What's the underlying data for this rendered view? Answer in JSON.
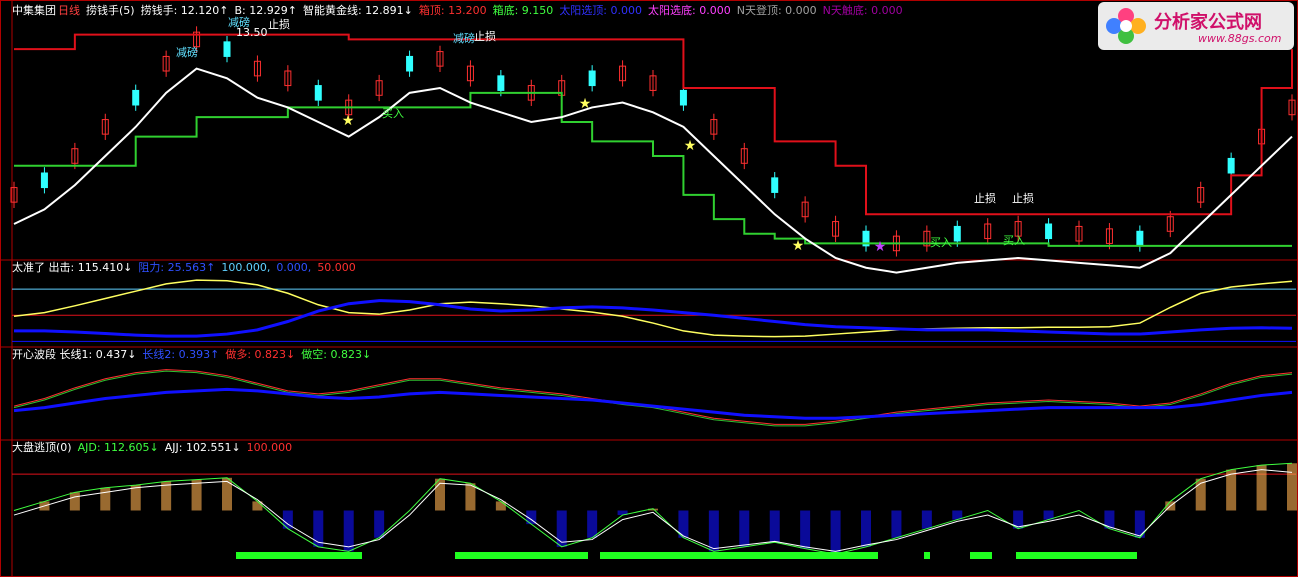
{
  "colors": {
    "bg": "#000000",
    "frame": "#b00000",
    "up_candle": "#ff3030",
    "down_candle": "#30ffff",
    "white_line": "#ffffff",
    "red_top": "#e0101a",
    "green_bottom": "#30d030",
    "yellow": "#ffff60",
    "blue": "#1010ff",
    "cyan": "#60d0ff",
    "orange": "#ffb050",
    "magenta": "#c040ff",
    "green_bar": "#20ff20"
  },
  "panel1": {
    "title": "中集集团",
    "period": "日线",
    "indicator": "捞钱手(5)",
    "values": [
      {
        "text": "捞钱手: 12.120↑",
        "color": "#ffffff"
      },
      {
        "text": "B: 12.929↑",
        "color": "#ffffff"
      },
      {
        "text": "智能黄金线: 12.891↓",
        "color": "#ffffff"
      },
      {
        "text": "箱顶: 13.200",
        "color": "#ff3030"
      },
      {
        "text": "箱底: 9.150",
        "color": "#40ff40"
      },
      {
        "text": "太阳选顶: 0.000",
        "color": "#3030ff"
      },
      {
        "text": "太阳选底: 0.000",
        "color": "#ff40ff"
      },
      {
        "text": "N天登顶: 0.000",
        "color": "#a0a0a0"
      },
      {
        "text": "N天触底: 0.000",
        "color": "#a000a0"
      }
    ],
    "annotations": [
      {
        "text": "减磅",
        "color": "#60e0ff"
      },
      {
        "text": "止损",
        "color": "#ffffff"
      },
      {
        "text": "减磅",
        "color": "#60e0ff"
      },
      {
        "text": "止损",
        "color": "#ffffff"
      },
      {
        "text": "减磅",
        "color": "#60e0ff"
      },
      {
        "text": "买入",
        "color": "#40ff40"
      },
      {
        "text": "止损",
        "color": "#ffffff"
      },
      {
        "text": "止损",
        "color": "#ffffff"
      },
      {
        "text": "买入",
        "color": "#40ff40"
      },
      {
        "text": "买入",
        "color": "#40ff40"
      },
      {
        "text": "13.50",
        "color": "#ffffff"
      }
    ]
  },
  "panel2": {
    "values": [
      {
        "text": "太准了 出击: 115.410↓",
        "color": "#ffffff"
      },
      {
        "text": "阻力: 25.563↑",
        "color": "#3050ff"
      },
      {
        "text": "100.000,",
        "color": "#60d0ff"
      },
      {
        "text": "0.000,",
        "color": "#3050ff"
      },
      {
        "text": "50.000",
        "color": "#ff3030"
      }
    ]
  },
  "panel3": {
    "values": [
      {
        "text": "开心波段 长线1: 0.437↓",
        "color": "#ffffff"
      },
      {
        "text": "长线2: 0.393↑",
        "color": "#3050ff"
      },
      {
        "text": "做多: 0.823↓",
        "color": "#ff3030"
      },
      {
        "text": "做空: 0.823↓",
        "color": "#40ff40"
      }
    ]
  },
  "panel4": {
    "values": [
      {
        "text": "大盘逃顶(0)",
        "color": "#ffffff"
      },
      {
        "text": "AJD: 112.605↓",
        "color": "#40ff40"
      },
      {
        "text": "AJJ: 102.551↓",
        "color": "#ffffff"
      },
      {
        "text": "100.000",
        "color": "#ff3030"
      }
    ]
  },
  "watermark": {
    "name": "分析家公式网",
    "url": "www.88gs.com"
  },
  "chart_data": {
    "type": "line",
    "series": [
      {
        "name": "捞钱手",
        "values": [
          10.2,
          10.5,
          11.0,
          11.6,
          12.2,
          12.9,
          13.4,
          13.2,
          12.8,
          12.6,
          12.3,
          12.0,
          12.4,
          12.9,
          13.0,
          12.7,
          12.5,
          12.3,
          12.4,
          12.6,
          12.7,
          12.5,
          12.2,
          11.6,
          11.0,
          10.4,
          9.9,
          9.5,
          9.3,
          9.2,
          9.3,
          9.4,
          9.45,
          9.5,
          9.45,
          9.4,
          9.35,
          9.3,
          9.6,
          10.2,
          10.8,
          11.4,
          12.0
        ]
      },
      {
        "name": "箱顶",
        "values": [
          13.2,
          13.2,
          13.5,
          13.5,
          13.5,
          13.5,
          13.5,
          13.5,
          13.5,
          13.5,
          13.5,
          13.4,
          13.4,
          13.4,
          13.4,
          13.4,
          13.4,
          13.4,
          13.4,
          13.4,
          13.4,
          13.4,
          12.4,
          12.4,
          12.4,
          11.3,
          11.3,
          10.8,
          9.8,
          9.8,
          9.8,
          9.8,
          9.8,
          9.8,
          9.8,
          9.8,
          9.8,
          9.8,
          9.8,
          9.8,
          10.6,
          12.4,
          13.2
        ]
      },
      {
        "name": "箱底",
        "values": [
          10.8,
          10.8,
          10.8,
          10.8,
          11.4,
          11.4,
          11.8,
          11.8,
          11.8,
          12.0,
          12.0,
          12.0,
          12.0,
          12.0,
          12.0,
          12.3,
          12.3,
          12.3,
          11.7,
          11.3,
          11.3,
          11.0,
          10.2,
          9.7,
          9.4,
          9.3,
          9.2,
          9.2,
          9.2,
          9.2,
          9.2,
          9.2,
          9.2,
          9.2,
          9.15,
          9.15,
          9.15,
          9.15,
          9.15,
          9.15,
          9.15,
          9.15,
          9.15
        ]
      },
      {
        "name": "出击",
        "values": [
          48,
          55,
          68,
          82,
          96,
          110,
          117,
          116,
          108,
          92,
          70,
          55,
          52,
          60,
          72,
          75,
          72,
          68,
          62,
          56,
          48,
          35,
          20,
          12,
          10,
          9,
          10,
          14,
          18,
          22,
          24,
          25,
          26,
          26,
          27,
          27,
          28,
          35,
          65,
          92,
          104,
          110,
          115
        ]
      },
      {
        "name": "阻力",
        "values": [
          20,
          20,
          18,
          15,
          12,
          10,
          10,
          14,
          22,
          38,
          58,
          72,
          78,
          76,
          70,
          62,
          58,
          60,
          64,
          66,
          64,
          60,
          55,
          50,
          44,
          38,
          32,
          28,
          26,
          24,
          22,
          22,
          22,
          20,
          18,
          16,
          14,
          14,
          18,
          22,
          25,
          26,
          25
        ]
      },
      {
        "name": "长线1",
        "values": [
          0.4,
          0.45,
          0.52,
          0.58,
          0.62,
          0.64,
          0.63,
          0.6,
          0.55,
          0.5,
          0.48,
          0.5,
          0.54,
          0.58,
          0.58,
          0.55,
          0.52,
          0.5,
          0.48,
          0.45,
          0.42,
          0.4,
          0.36,
          0.32,
          0.3,
          0.28,
          0.28,
          0.3,
          0.33,
          0.36,
          0.38,
          0.4,
          0.42,
          0.43,
          0.44,
          0.43,
          0.42,
          0.4,
          0.42,
          0.48,
          0.55,
          0.6,
          0.62
        ]
      },
      {
        "name": "长线2",
        "values": [
          0.38,
          0.4,
          0.43,
          0.46,
          0.48,
          0.5,
          0.51,
          0.52,
          0.51,
          0.49,
          0.47,
          0.46,
          0.47,
          0.49,
          0.5,
          0.49,
          0.48,
          0.47,
          0.46,
          0.45,
          0.43,
          0.41,
          0.39,
          0.37,
          0.35,
          0.34,
          0.33,
          0.33,
          0.34,
          0.35,
          0.36,
          0.37,
          0.38,
          0.39,
          0.4,
          0.4,
          0.4,
          0.4,
          0.4,
          0.42,
          0.45,
          0.48,
          0.5
        ]
      },
      {
        "name": "AJD",
        "values": [
          60,
          70,
          80,
          85,
          88,
          92,
          94,
          96,
          70,
          40,
          20,
          15,
          30,
          60,
          95,
          90,
          70,
          45,
          20,
          30,
          55,
          62,
          30,
          15,
          20,
          25,
          18,
          12,
          20,
          30,
          40,
          50,
          60,
          40,
          50,
          60,
          40,
          30,
          70,
          95,
          105,
          110,
          112
        ]
      },
      {
        "name": "AJJ",
        "values": [
          55,
          65,
          75,
          80,
          85,
          88,
          90,
          92,
          72,
          45,
          25,
          20,
          28,
          55,
          90,
          88,
          72,
          50,
          25,
          28,
          50,
          58,
          32,
          18,
          22,
          26,
          20,
          15,
          22,
          28,
          38,
          48,
          55,
          42,
          48,
          55,
          42,
          32,
          65,
          90,
          100,
          105,
          102
        ]
      }
    ]
  }
}
